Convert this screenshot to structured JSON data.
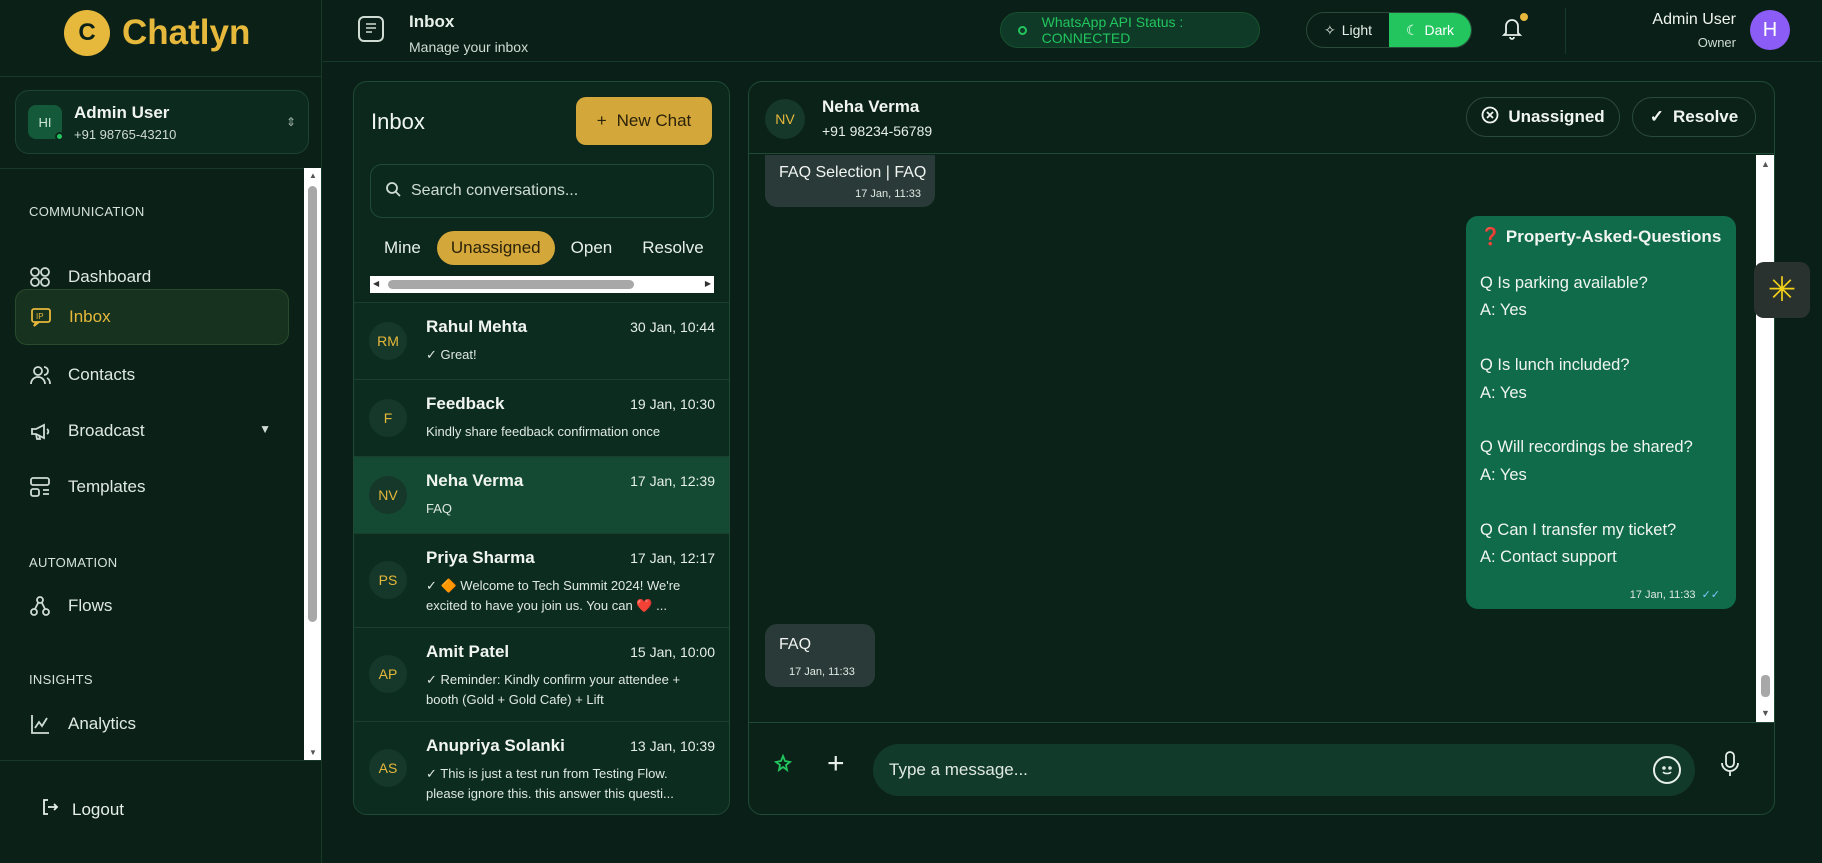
{
  "brand": {
    "name": "Chatlyn",
    "mark": "C"
  },
  "sidebar": {
    "user": {
      "initials": "HI",
      "name": "Admin User",
      "phone": "+91 98765-43210"
    },
    "sections": [
      {
        "label": "COMMUNICATION",
        "items": [
          {
            "label": "Dashboard",
            "icon": "dashboard-icon"
          },
          {
            "label": "Inbox",
            "icon": "inbox-icon",
            "active": true
          },
          {
            "label": "Contacts",
            "icon": "contacts-icon"
          },
          {
            "label": "Broadcast",
            "icon": "megaphone-icon"
          },
          {
            "label": "Templates",
            "icon": "templates-icon"
          }
        ]
      },
      {
        "label": "AUTOMATION",
        "items": [
          {
            "label": "Flows",
            "icon": "flows-icon"
          }
        ]
      },
      {
        "label": "INSIGHTS",
        "items": [
          {
            "label": "Analytics",
            "icon": "analytics-icon"
          }
        ]
      }
    ],
    "logout": "Logout"
  },
  "topbar": {
    "title": "Inbox",
    "subtitle": "Manage your inbox",
    "wa_status": "WhatsApp API Status : CONNECTED",
    "theme": {
      "light": "Light",
      "dark": "Dark",
      "selected": "Dark"
    },
    "user": {
      "name": "Admin User",
      "role": "Owner",
      "initial": "H"
    },
    "colors": {
      "accent": "#e6b83b",
      "success": "#22c55e",
      "avatar": "#8b5cf6"
    }
  },
  "inbox": {
    "title": "Inbox",
    "new_chat": "New Chat",
    "search_placeholder": "Search conversations...",
    "filters": [
      "Mine",
      "Unassigned",
      "Open",
      "Resolve"
    ],
    "active_filter": "Unassigned",
    "conversations": [
      {
        "initials": "RM",
        "name": "Rahul Mehta",
        "time": "30 Jan, 10:44",
        "preview": "✓ Great!"
      },
      {
        "initials": "F",
        "name": "Feedback",
        "time": "19 Jan, 10:30",
        "preview": "Kindly share feedback confirmation once"
      },
      {
        "initials": "NV",
        "name": "Neha Verma",
        "time": "17 Jan, 12:39",
        "preview": "FAQ",
        "selected": true
      },
      {
        "initials": "PS",
        "name": "Priya Sharma",
        "time": "17 Jan, 12:17",
        "preview": "✓ 🔶 Welcome to Tech Summit 2024! We're excited to have you join us. You can ❤️ ..."
      },
      {
        "initials": "AP",
        "name": "Amit Patel",
        "time": "15 Jan, 10:00",
        "preview": "✓ Reminder: Kindly confirm your attendee + booth (Gold + Gold Cafe) + Lift"
      },
      {
        "initials": "AS",
        "name": "Anupriya Solanki",
        "time": "13 Jan, 10:39",
        "preview": "✓ This is just a test run from Testing Flow. please ignore this. this answer this questi..."
      }
    ]
  },
  "chat": {
    "contact": {
      "initials": "NV",
      "name": "Neha Verma",
      "phone": "+91 98234-56789"
    },
    "assign_label": "Unassigned",
    "resolve_label": "Resolve",
    "messages": [
      {
        "direction": "in",
        "text": "FAQ Selection | FAQ",
        "time": "17 Jan, 11:33"
      },
      {
        "direction": "out",
        "title": "❓ Property-Asked-Questions",
        "lines": [
          "Q Is parking available?",
          "A: Yes",
          "",
          "Q Is lunch included?",
          "A: Yes",
          "",
          "Q Will recordings be shared?",
          "A: Yes",
          "",
          "Q Can I transfer my ticket?",
          "A: Contact support"
        ],
        "time": "17 Jan, 11:33",
        "ticks": "✓✓"
      },
      {
        "direction": "in",
        "text": "FAQ",
        "time": "17 Jan, 11:33"
      }
    ],
    "input_placeholder": "Type a message..."
  }
}
